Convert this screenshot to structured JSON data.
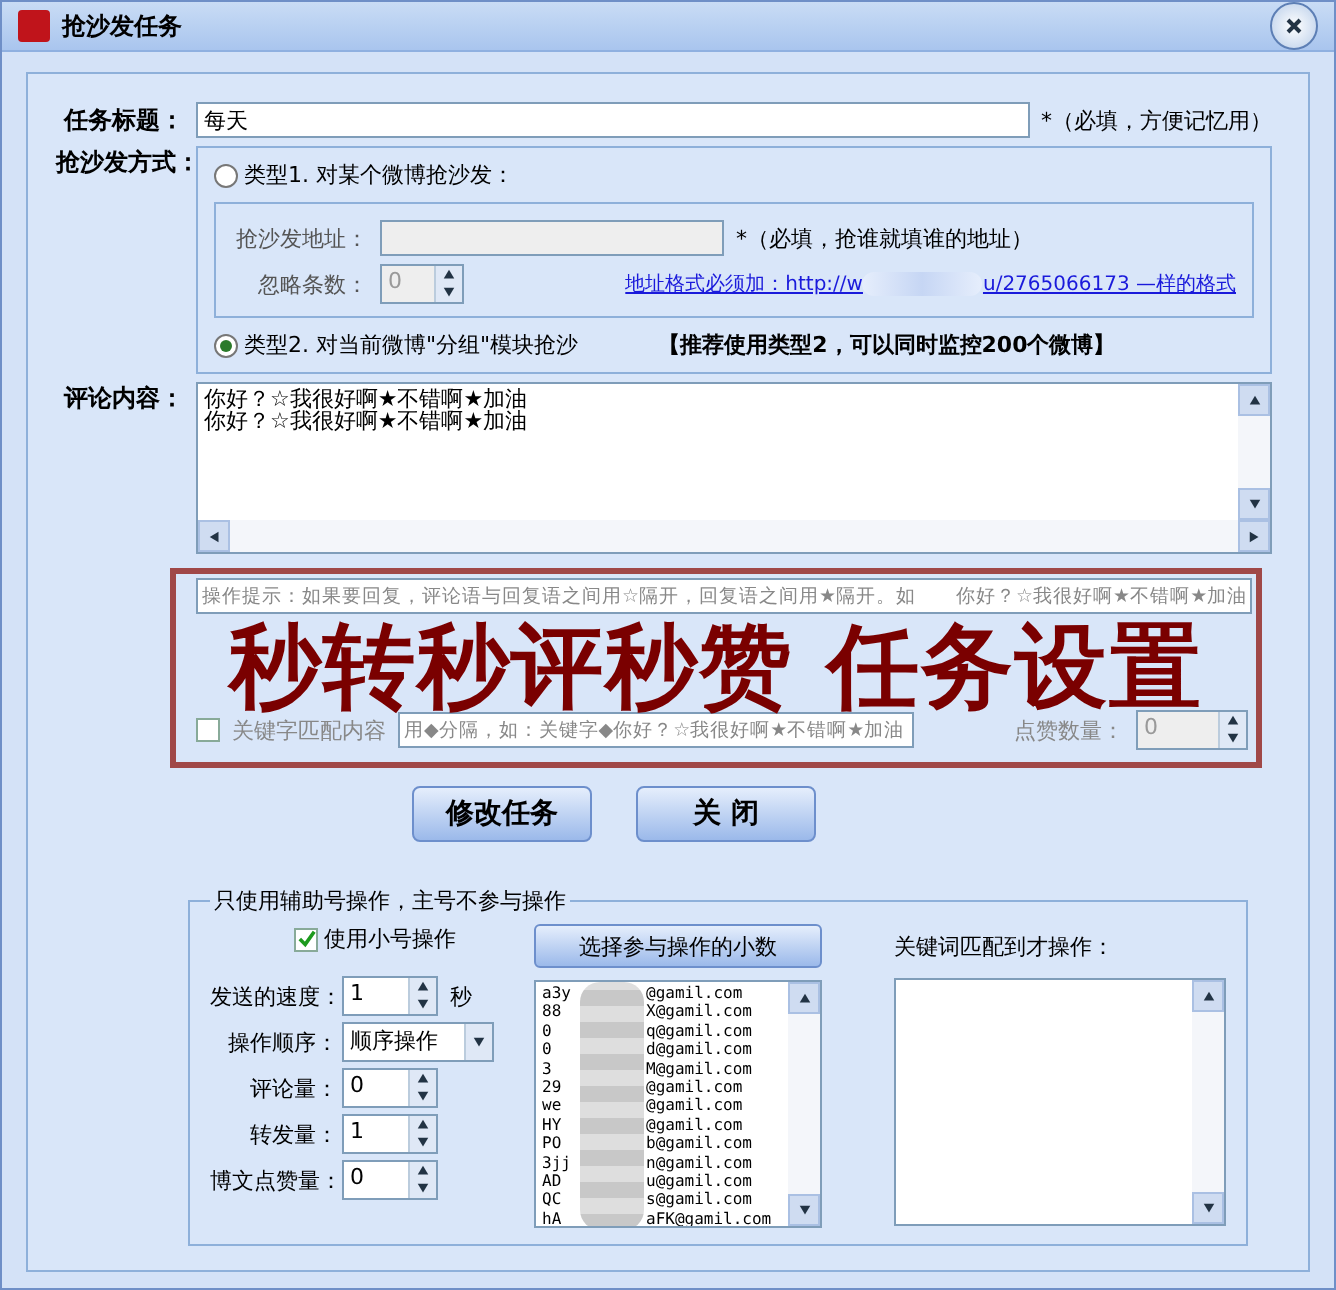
{
  "window": {
    "title": "抢沙发任务"
  },
  "task_title": {
    "label": "任务标题：",
    "value": "每天",
    "note": "*（必填，方便记忆用）"
  },
  "method": {
    "label": "抢沙发方式：",
    "address_label": "抢沙发地址：",
    "address_note": "*（必填，抢谁就填谁的地址）",
    "skip_label": "忽略条数：",
    "skip_value": "0",
    "link_start": "地址格式必须加：http://w",
    "link_end": "u/2765066173 —样的格式",
    "recommend": "【推荐使用类型2，可以同时监控200个微博】",
    "options": [
      {
        "label": "类型1. 对某个微博抢沙发：",
        "selected": false
      },
      {
        "label": "类型2. 对当前微博\"分组\"模块抢沙",
        "selected": true
      }
    ]
  },
  "comment": {
    "label": "评论内容：",
    "lines": [
      "你好？☆我很好啊★不错啊★加油",
      "你好？☆我很好啊★不错啊★加油"
    ]
  },
  "hint": {
    "placeholder": "操作提示：如果要回复，评论语与回复语之间用☆隔开，回复语之间用★隔开。如　　你好？☆我很好啊★不错啊★加油"
  },
  "keyword_match": {
    "label": "关键字匹配内容",
    "checked": false,
    "placeholder": "用◆分隔，如：关键字◆你好？☆我很好啊★不错啊★加油"
  },
  "like_count": {
    "label": "点赞数量：",
    "value": "0"
  },
  "banner": "秒转秒评秒赞 任务设置",
  "buttons": [
    "修改任务",
    "关 闭"
  ],
  "helper": {
    "title": "只使用辅助号操作，主号不参与操作",
    "use_small": {
      "label": "使用小号操作",
      "checked": true
    },
    "select_button": "选择参与操作的小数",
    "keyword_label": "关键词匹配到才操作：",
    "fields": [
      {
        "kind": "spin",
        "label": "发送的速度：",
        "value": "1",
        "unit": "秒"
      },
      {
        "kind": "select",
        "label": "操作顺序：",
        "value": "顺序操作"
      },
      {
        "kind": "spin",
        "label": "评论量：",
        "value": "0"
      },
      {
        "kind": "spin",
        "label": "转发量：",
        "value": "1"
      },
      {
        "kind": "spin",
        "label": "博文点赞量：",
        "value": "0"
      }
    ],
    "accounts": [
      {
        "start": "a3y",
        "end": "@gamil.com"
      },
      {
        "start": "88",
        "end": "X@gamil.com"
      },
      {
        "start": "0",
        "end": "q@gamil.com"
      },
      {
        "start": "0",
        "end": "d@gamil.com"
      },
      {
        "start": "3",
        "end": "M@gamil.com"
      },
      {
        "start": "29",
        "end": "@gamil.com"
      },
      {
        "start": "we",
        "end": "@gamil.com"
      },
      {
        "start": "HY",
        "end": "@gamil.com"
      },
      {
        "start": "PO",
        "end": "b@gamil.com"
      },
      {
        "start": "3jj",
        "end": "n@gamil.com"
      },
      {
        "start": "AD",
        "end": "u@gamil.com"
      },
      {
        "start": "QC",
        "end": "s@gamil.com"
      },
      {
        "start": "hA",
        "end": "aFK@gamil.com"
      }
    ]
  }
}
